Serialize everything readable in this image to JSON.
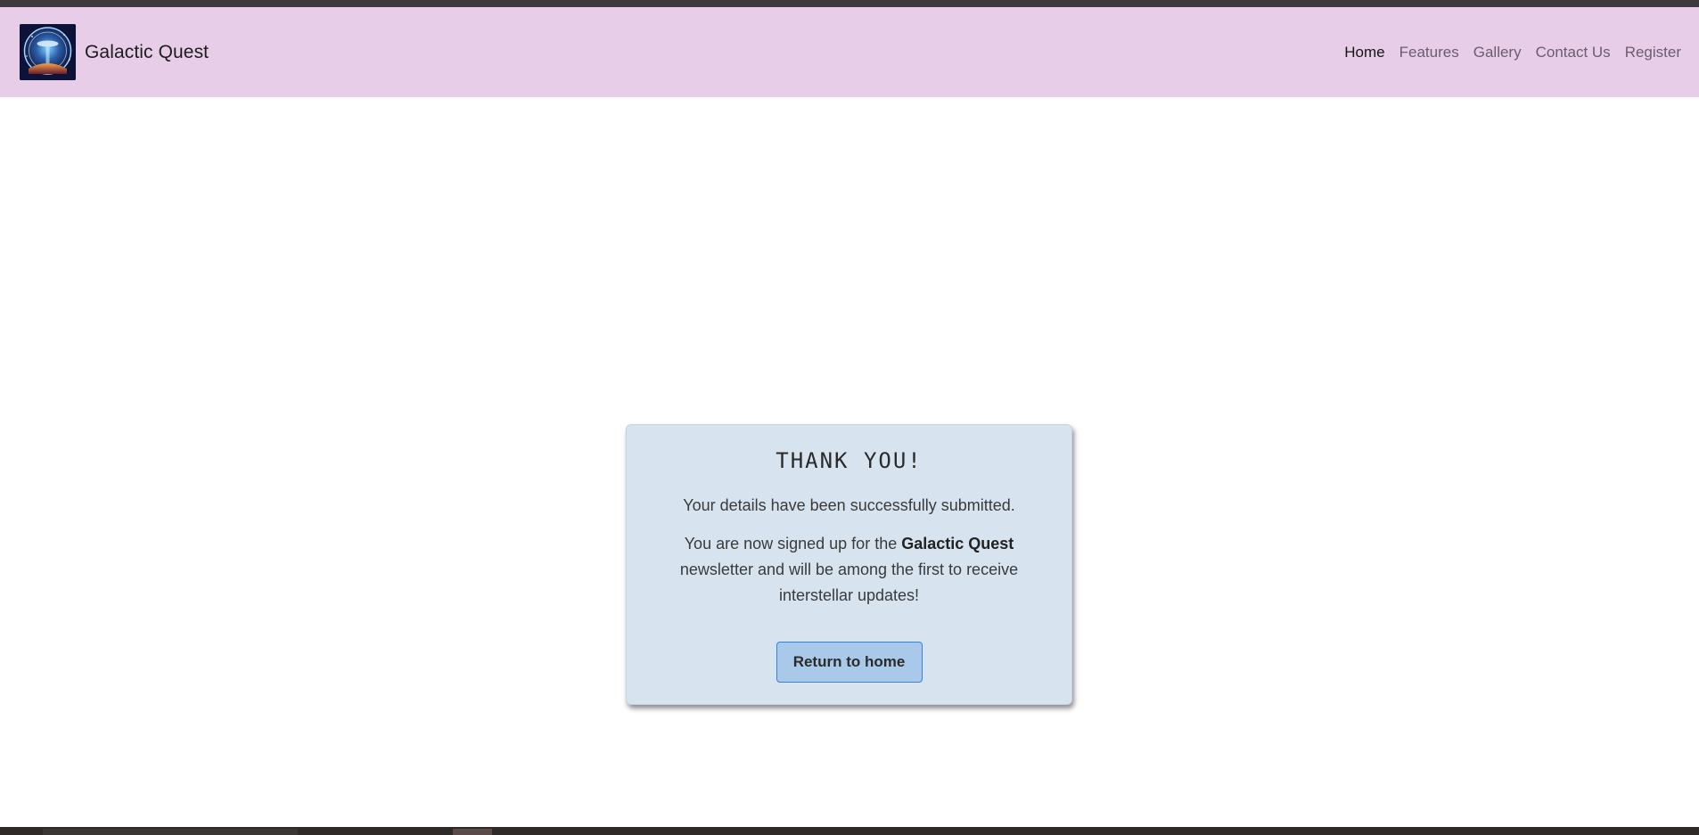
{
  "site": {
    "brand_name": "Galactic Quest",
    "logo_icon": "galactic-quest-logo"
  },
  "nav": {
    "items": [
      {
        "label": "Home",
        "active": true
      },
      {
        "label": "Features",
        "active": false
      },
      {
        "label": "Gallery",
        "active": false
      },
      {
        "label": "Contact Us",
        "active": false
      },
      {
        "label": "Register",
        "active": false
      }
    ]
  },
  "card": {
    "title": "THANK YOU!",
    "line1": "Your details have been successfully submitted.",
    "line2_before": "You are now signed up for the ",
    "line2_bold": "Galactic Quest",
    "line2_after": " newsletter and will be among the first to receive interstellar updates!",
    "button_label": "Return to home"
  },
  "colors": {
    "navbar_bg": "#e8cde9",
    "card_bg": "#d7e4f0",
    "button_bg": "#a9c9ea",
    "button_border": "#3b7fd6"
  }
}
